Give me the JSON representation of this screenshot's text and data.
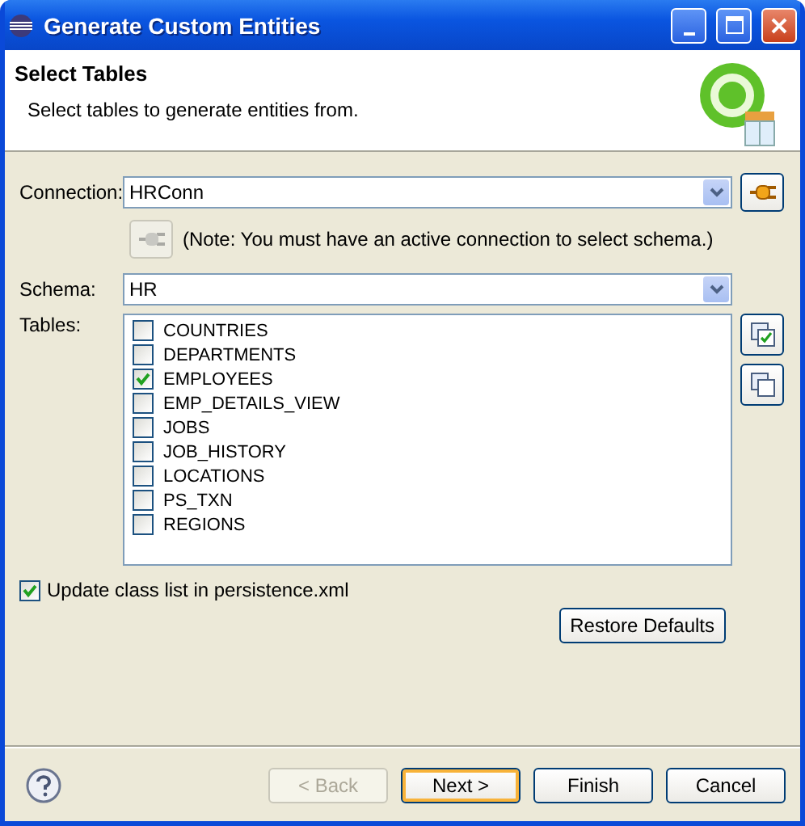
{
  "window": {
    "title": "Generate Custom Entities"
  },
  "header": {
    "title": "Select Tables",
    "description": "Select tables to generate entities from."
  },
  "connection": {
    "label": "Connection:",
    "value": "HRConn"
  },
  "note": {
    "text": "(Note: You must have an active connection to select schema.)",
    "button_disabled": true
  },
  "schema": {
    "label": "Schema:",
    "value": "HR"
  },
  "tables": {
    "label": "Tables:",
    "items": [
      {
        "name": "COUNTRIES",
        "checked": false
      },
      {
        "name": "DEPARTMENTS",
        "checked": false
      },
      {
        "name": "EMPLOYEES",
        "checked": true
      },
      {
        "name": "EMP_DETAILS_VIEW",
        "checked": false
      },
      {
        "name": "JOBS",
        "checked": false
      },
      {
        "name": "JOB_HISTORY",
        "checked": false
      },
      {
        "name": "LOCATIONS",
        "checked": false
      },
      {
        "name": "PS_TXN",
        "checked": false
      },
      {
        "name": "REGIONS",
        "checked": false
      }
    ]
  },
  "update_class_list": {
    "label": "Update class list in persistence.xml",
    "checked": true
  },
  "restore_defaults": "Restore Defaults",
  "buttons": [
    {
      "label": "< Back",
      "disabled": true,
      "focused": false
    },
    {
      "label": "Next >",
      "disabled": false,
      "focused": true
    },
    {
      "label": "Finish",
      "disabled": false,
      "focused": false
    },
    {
      "label": "Cancel",
      "disabled": false,
      "focused": false
    }
  ]
}
